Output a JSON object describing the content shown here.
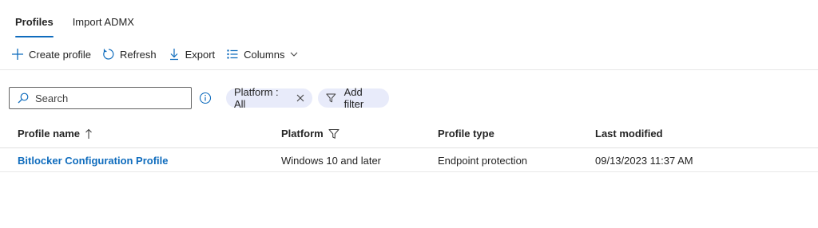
{
  "tabs": [
    {
      "label": "Profiles",
      "active": true
    },
    {
      "label": "Import ADMX",
      "active": false
    }
  ],
  "toolbar": {
    "create_label": "Create profile",
    "refresh_label": "Refresh",
    "export_label": "Export",
    "columns_label": "Columns"
  },
  "search": {
    "placeholder": "Search",
    "value": ""
  },
  "filters": {
    "platform_label": "Platform : All",
    "add_filter_label": "Add filter"
  },
  "table": {
    "columns": [
      "Profile name",
      "Platform",
      "Profile type",
      "Last modified"
    ],
    "rows": [
      {
        "profile_name": "Bitlocker Configuration Profile",
        "platform": "Windows 10 and later",
        "profile_type": "Endpoint protection",
        "last_modified": "09/13/2023 11:37 AM"
      }
    ]
  },
  "colors": {
    "accent": "#0f6cbd",
    "pill_bg": "#e8ebfa",
    "text": "#242424"
  }
}
